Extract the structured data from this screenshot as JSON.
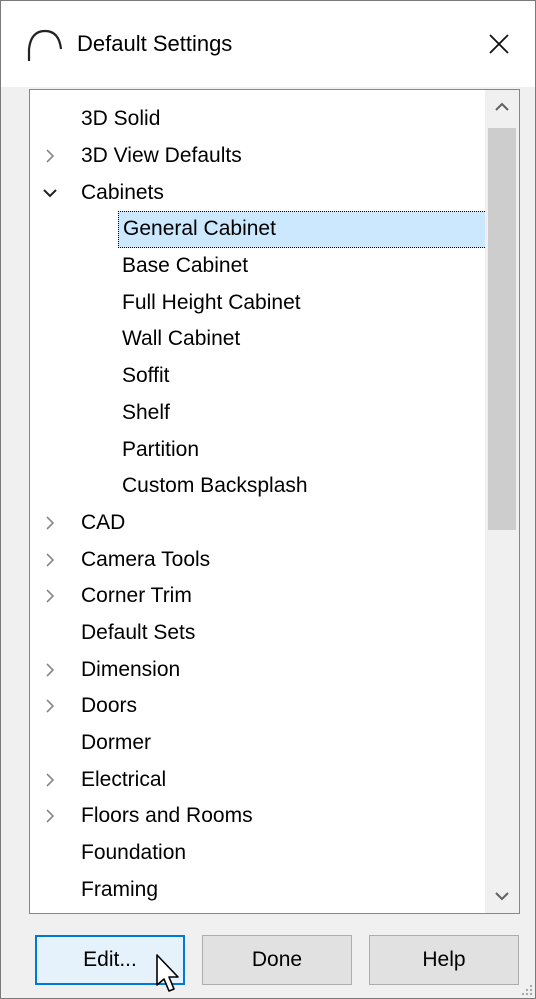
{
  "window": {
    "title": "Default Settings",
    "icon": "arch-icon",
    "close_icon": "close-icon"
  },
  "tree": {
    "items": [
      {
        "label": "3D Solid",
        "level": 0,
        "expander": "none"
      },
      {
        "label": "3D View Defaults",
        "level": 0,
        "expander": "collapsed"
      },
      {
        "label": "Cabinets",
        "level": 0,
        "expander": "expanded"
      },
      {
        "label": "General Cabinet",
        "level": 1,
        "expander": "none",
        "selected": true
      },
      {
        "label": "Base Cabinet",
        "level": 1,
        "expander": "none"
      },
      {
        "label": "Full Height Cabinet",
        "level": 1,
        "expander": "none"
      },
      {
        "label": "Wall Cabinet",
        "level": 1,
        "expander": "none"
      },
      {
        "label": "Soffit",
        "level": 1,
        "expander": "none"
      },
      {
        "label": "Shelf",
        "level": 1,
        "expander": "none"
      },
      {
        "label": "Partition",
        "level": 1,
        "expander": "none"
      },
      {
        "label": "Custom Backsplash",
        "level": 1,
        "expander": "none"
      },
      {
        "label": "CAD",
        "level": 0,
        "expander": "collapsed"
      },
      {
        "label": "Camera Tools",
        "level": 0,
        "expander": "collapsed"
      },
      {
        "label": "Corner Trim",
        "level": 0,
        "expander": "collapsed"
      },
      {
        "label": "Default Sets",
        "level": 0,
        "expander": "none"
      },
      {
        "label": "Dimension",
        "level": 0,
        "expander": "collapsed"
      },
      {
        "label": "Doors",
        "level": 0,
        "expander": "collapsed"
      },
      {
        "label": "Dormer",
        "level": 0,
        "expander": "none"
      },
      {
        "label": "Electrical",
        "level": 0,
        "expander": "collapsed"
      },
      {
        "label": "Floors and Rooms",
        "level": 0,
        "expander": "collapsed"
      },
      {
        "label": "Foundation",
        "level": 0,
        "expander": "none"
      },
      {
        "label": "Framing",
        "level": 0,
        "expander": "none"
      }
    ],
    "scroll_position": 0.0
  },
  "buttons": {
    "edit_label": "Edit...",
    "done_label": "Done",
    "help_label": "Help"
  },
  "colors": {
    "selection": "#cce8ff",
    "default_button_border": "#0078d7"
  }
}
